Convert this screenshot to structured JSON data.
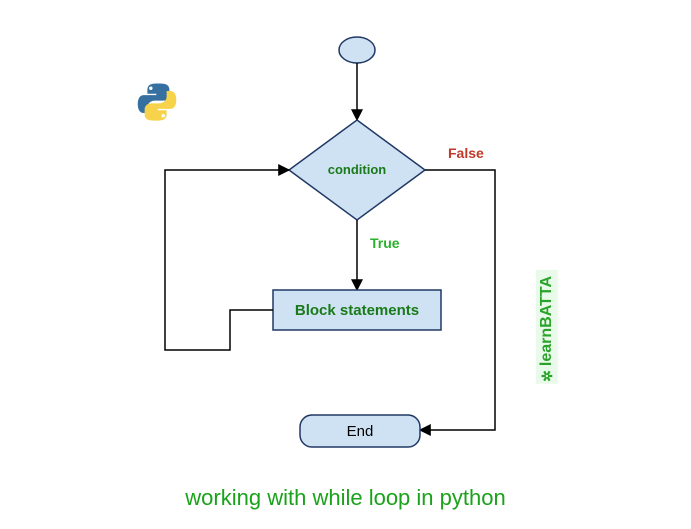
{
  "diagram": {
    "condition_label": "condition",
    "true_label": "True",
    "false_label": "False",
    "block_label": "Block statements",
    "end_label": "End"
  },
  "caption": "working with while loop in python",
  "watermark": "learnBATTA",
  "colors": {
    "node_fill": "#cfe2f3",
    "node_stroke": "#203864",
    "label_green": "#1a7a1a",
    "true_green": "#2bb02b",
    "false_red": "#c0392b"
  },
  "chart_data": {
    "type": "flowchart",
    "title": "working with while loop in python",
    "nodes": [
      {
        "id": "start",
        "type": "terminator-ellipse",
        "label": ""
      },
      {
        "id": "condition",
        "type": "decision-diamond",
        "label": "condition"
      },
      {
        "id": "block",
        "type": "process-rect",
        "label": "Block statements"
      },
      {
        "id": "end",
        "type": "terminator-rounded",
        "label": "End"
      }
    ],
    "edges": [
      {
        "from": "start",
        "to": "condition",
        "label": ""
      },
      {
        "from": "condition",
        "to": "block",
        "label": "True"
      },
      {
        "from": "block",
        "to": "condition",
        "label": ""
      },
      {
        "from": "condition",
        "to": "end",
        "label": "False"
      }
    ]
  }
}
